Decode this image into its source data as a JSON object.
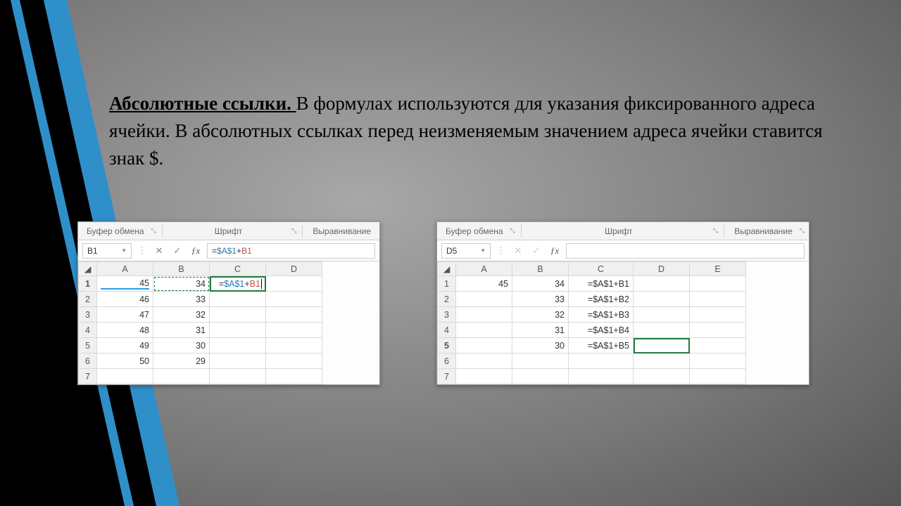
{
  "text": {
    "headline": "Абсолютные ссылки. ",
    "body": "В формулах используются для указания фиксированного адреса ячейки. В абсолютных ссылках перед неизменяемым значением адреса ячейки ставится знак $."
  },
  "ribbon": {
    "clipboard": "Буфер обмена",
    "font": "Шрифт",
    "align": "Выравнивание",
    "launcher": "⤡"
  },
  "fx": {
    "cancel": "✕",
    "accept": "✓",
    "fx": "ƒx",
    "dots": "⋮"
  },
  "left": {
    "namebox": "B1",
    "formula_plain": "=$A$1+B1",
    "formula": {
      "eq": "=",
      "a": "$A$1",
      "plus": "+",
      "b": "B1"
    },
    "cols": [
      "A",
      "B",
      "C",
      "D"
    ],
    "rows": [
      {
        "n": "1",
        "a": "45",
        "b": "34",
        "c": "=$A$1+B1",
        "d": ""
      },
      {
        "n": "2",
        "a": "46",
        "b": "33",
        "c": "",
        "d": ""
      },
      {
        "n": "3",
        "a": "47",
        "b": "32",
        "c": "",
        "d": ""
      },
      {
        "n": "4",
        "a": "48",
        "b": "31",
        "c": "",
        "d": ""
      },
      {
        "n": "5",
        "a": "49",
        "b": "30",
        "c": "",
        "d": ""
      },
      {
        "n": "6",
        "a": "50",
        "b": "29",
        "c": "",
        "d": ""
      },
      {
        "n": "7",
        "a": "",
        "b": "",
        "c": "",
        "d": ""
      }
    ]
  },
  "right": {
    "namebox": "D5",
    "formula_plain": "",
    "cols": [
      "A",
      "B",
      "C",
      "D",
      "E"
    ],
    "rows": [
      {
        "n": "1",
        "a": "45",
        "b": "34",
        "c": "=$A$1+B1",
        "d": "",
        "e": ""
      },
      {
        "n": "2",
        "a": "",
        "b": "33",
        "c": "=$A$1+B2",
        "d": "",
        "e": ""
      },
      {
        "n": "3",
        "a": "",
        "b": "32",
        "c": "=$A$1+B3",
        "d": "",
        "e": ""
      },
      {
        "n": "4",
        "a": "",
        "b": "31",
        "c": "=$A$1+B4",
        "d": "",
        "e": ""
      },
      {
        "n": "5",
        "a": "",
        "b": "30",
        "c": "=$A$1+B5",
        "d": "",
        "e": ""
      },
      {
        "n": "6",
        "a": "",
        "b": "",
        "c": "",
        "d": "",
        "e": ""
      },
      {
        "n": "7",
        "a": "",
        "b": "",
        "c": "",
        "d": "",
        "e": ""
      }
    ]
  }
}
